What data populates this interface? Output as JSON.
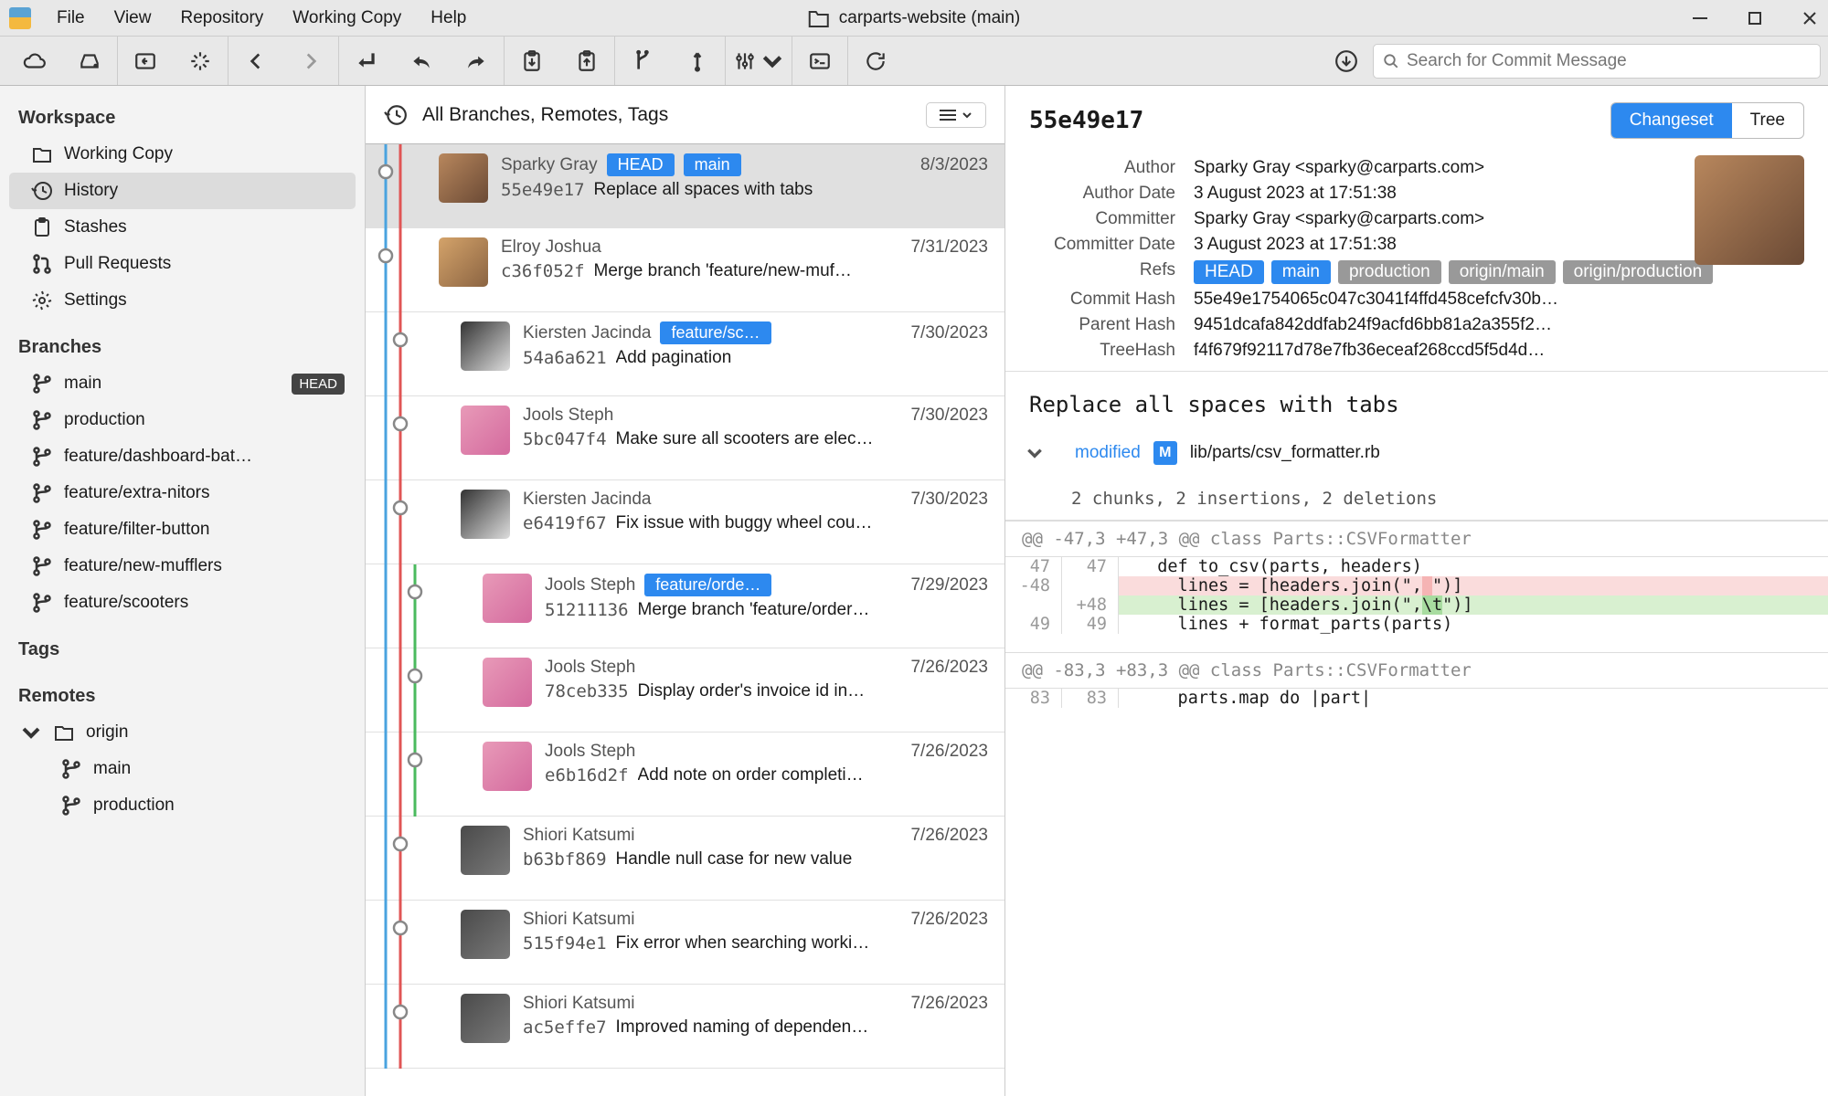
{
  "menu": {
    "file": "File",
    "view": "View",
    "repository": "Repository",
    "working_copy": "Working Copy",
    "help": "Help"
  },
  "repo_title": "carparts-website (main)",
  "search": {
    "placeholder": "Search for Commit Message"
  },
  "sidebar": {
    "workspace_heading": "Workspace",
    "working_copy": "Working Copy",
    "history": "History",
    "stashes": "Stashes",
    "pull_requests": "Pull Requests",
    "settings": "Settings",
    "branches_heading": "Branches",
    "tags_heading": "Tags",
    "remotes_heading": "Remotes",
    "head_label": "HEAD",
    "branches": [
      "main",
      "production",
      "feature/dashboard-bat…",
      "feature/extra-nitors",
      "feature/filter-button",
      "feature/new-mufflers",
      "feature/scooters"
    ],
    "remote_name": "origin",
    "remote_branches": [
      "main",
      "production"
    ]
  },
  "commit_head": {
    "filter": "All Branches, Remotes, Tags"
  },
  "commits": [
    {
      "author": "Sparky Gray",
      "refs": [
        "HEAD",
        "main"
      ],
      "date": "8/3/2023",
      "hash": "55e49e17",
      "msg": "Replace all spaces with tabs",
      "avatar": "a1",
      "indent": 0
    },
    {
      "author": "Elroy Joshua",
      "refs": [],
      "date": "7/31/2023",
      "hash": "c36f052f",
      "msg": "Merge branch 'feature/new-muf…",
      "avatar": "a2",
      "indent": 0
    },
    {
      "author": "Kiersten Jacinda",
      "refs": [
        "feature/sc…"
      ],
      "date": "7/30/2023",
      "hash": "54a6a621",
      "msg": "Add pagination",
      "avatar": "a3",
      "indent": 1
    },
    {
      "author": "Jools Steph",
      "refs": [],
      "date": "7/30/2023",
      "hash": "5bc047f4",
      "msg": "Make sure all scooters are elec…",
      "avatar": "a4",
      "indent": 1
    },
    {
      "author": "Kiersten Jacinda",
      "refs": [],
      "date": "7/30/2023",
      "hash": "e6419f67",
      "msg": "Fix issue with buggy wheel cou…",
      "avatar": "a3",
      "indent": 1
    },
    {
      "author": "Jools Steph",
      "refs": [
        "feature/orde…"
      ],
      "date": "7/29/2023",
      "hash": "51211136",
      "msg": "Merge branch 'feature/order…",
      "avatar": "a4",
      "indent": 2
    },
    {
      "author": "Jools Steph",
      "refs": [],
      "date": "7/26/2023",
      "hash": "78ceb335",
      "msg": "Display order's invoice id in…",
      "avatar": "a4",
      "indent": 2
    },
    {
      "author": "Jools Steph",
      "refs": [],
      "date": "7/26/2023",
      "hash": "e6b16d2f",
      "msg": "Add note on order completi…",
      "avatar": "a4",
      "indent": 2
    },
    {
      "author": "Shiori Katsumi",
      "refs": [],
      "date": "7/26/2023",
      "hash": "b63bf869",
      "msg": "Handle null case for new value",
      "avatar": "a5",
      "indent": 1
    },
    {
      "author": "Shiori Katsumi",
      "refs": [],
      "date": "7/26/2023",
      "hash": "515f94e1",
      "msg": "Fix error when searching worki…",
      "avatar": "a5",
      "indent": 1
    },
    {
      "author": "Shiori Katsumi",
      "refs": [],
      "date": "7/26/2023",
      "hash": "ac5effe7",
      "msg": "Improved naming of dependen…",
      "avatar": "a5",
      "indent": 1
    }
  ],
  "detail": {
    "short_hash": "55e49e17",
    "changeset": "Changeset",
    "tree": "Tree",
    "labels": {
      "author": "Author",
      "author_date": "Author Date",
      "committer": "Committer",
      "committer_date": "Committer Date",
      "refs": "Refs",
      "commit_hash": "Commit Hash",
      "parent_hash": "Parent Hash",
      "tree_hash": "TreeHash"
    },
    "author": "Sparky Gray <sparky@carparts.com>",
    "author_date": "3 August 2023 at 17:51:38",
    "committer": "Sparky Gray <sparky@carparts.com>",
    "committer_date": "3 August 2023 at 17:51:38",
    "refs_blue": [
      "HEAD",
      "main"
    ],
    "refs_gray": [
      "production",
      "origin/main",
      "origin/production"
    ],
    "commit_hash": "55e49e1754065c047c3041f4ffd458cefcfv30b…",
    "parent_hash": "9451dcafa842ddfab24f9acfd6bb81a2a355f2…",
    "tree_hash": "f4f679f92117d78e7fb36eceaf268ccd5f5d4d…",
    "title": "Replace all spaces with tabs",
    "modified_label": "modified",
    "file_badge": "M",
    "file_path": "lib/parts/csv_formatter.rb",
    "chunks_summary": "2 chunks, 2 insertions, 2 deletions",
    "hunk1": "@@ -47,3 +47,3 @@ class Parts::CSVFormatter",
    "hunk2": "@@ -83,3 +83,3 @@ class Parts::CSVFormatter",
    "lines1": [
      {
        "old": "47",
        "new": "47",
        "type": "ctx",
        "code": "  def to_csv(parts, headers)"
      },
      {
        "old": "-48",
        "new": "",
        "type": "del",
        "code_pre": "    lines = [headers.join(\",",
        "code_hl": " ",
        "code_post": "\")]"
      },
      {
        "old": "",
        "new": "+48",
        "type": "add",
        "code_pre": "    lines = [headers.join(\",",
        "code_hl": "\\t",
        "code_post": "\")]"
      },
      {
        "old": "49",
        "new": "49",
        "type": "ctx",
        "code": "    lines + format_parts(parts)"
      }
    ],
    "lines2": [
      {
        "old": "83",
        "new": "83",
        "type": "ctx",
        "code": "    parts.map do |part|"
      }
    ]
  }
}
